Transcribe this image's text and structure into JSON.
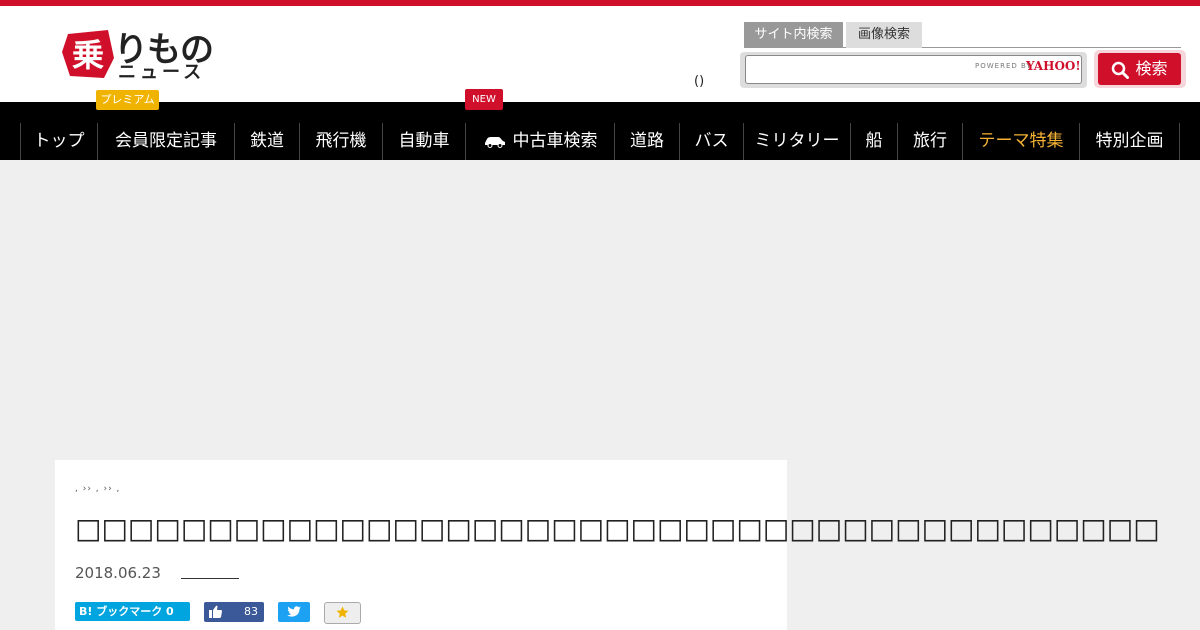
{
  "brand": {
    "logo_top": "りもの",
    "logo_bottom": "ニュース",
    "logo_kanji": "乗",
    "premium": "プレミアム",
    "new_badge": "NEW",
    "accent": "#d0102b"
  },
  "header": {
    "paren_text": "()"
  },
  "search": {
    "tab_site": "サイト内検索",
    "tab_image": "画像検索",
    "input_value": "",
    "powered": "POWERED BY",
    "provider": "YAHOO!",
    "button_label": "検索"
  },
  "nav": {
    "items": [
      {
        "label": "トップ"
      },
      {
        "label": "会員限定記事"
      },
      {
        "label": "鉄道"
      },
      {
        "label": "飛行機"
      },
      {
        "label": "自動車"
      },
      {
        "label": "中古車検索",
        "icon": "car-icon"
      },
      {
        "label": "道路"
      },
      {
        "label": "バス"
      },
      {
        "label": "ミリタリー"
      },
      {
        "label": "船"
      },
      {
        "label": "旅行"
      },
      {
        "label": "テーマ特集"
      },
      {
        "label": "特別企画"
      }
    ]
  },
  "article": {
    "breadcrumb": ", ›› , ›› ,",
    "title": "□□□□□□□□□□□□□□□□□□□□□□□□□□□□□□□□□□□□□□□□□",
    "date": "2018.06.23",
    "share": {
      "hatena_label": "B! ブックマーク 0",
      "fb_count": "83"
    }
  }
}
